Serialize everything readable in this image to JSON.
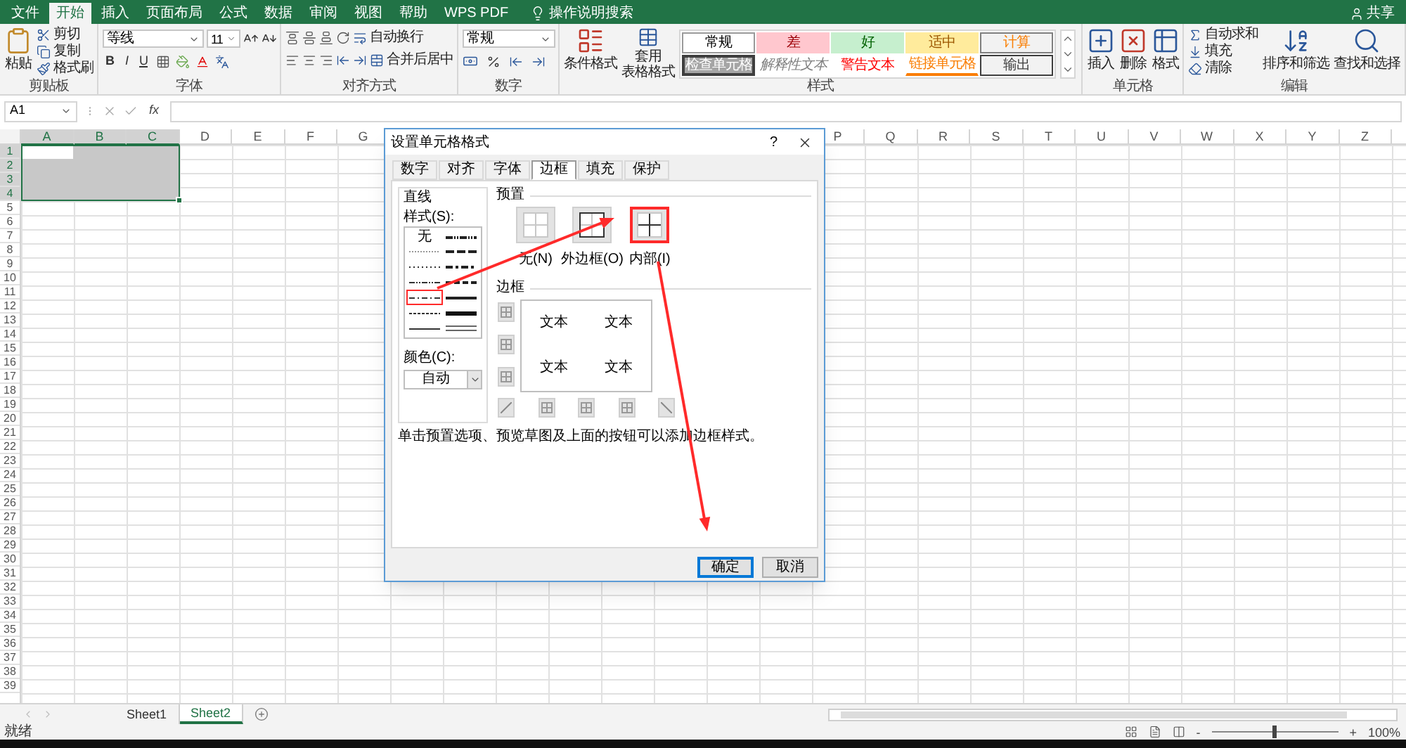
{
  "title_bar": {
    "tabs": [
      {
        "label": "文件",
        "selected": false
      },
      {
        "label": "开始",
        "selected": true
      },
      {
        "label": "插入",
        "selected": false
      },
      {
        "label": "页面布局",
        "selected": false
      },
      {
        "label": "公式",
        "selected": false
      },
      {
        "label": "数据",
        "selected": false
      },
      {
        "label": "审阅",
        "selected": false
      },
      {
        "label": "视图",
        "selected": false
      },
      {
        "label": "帮助",
        "selected": false
      },
      {
        "label": "WPS PDF",
        "selected": false
      }
    ],
    "search": "操作说明搜索",
    "share": "共享"
  },
  "ribbon": {
    "clipboard": {
      "paste": "粘贴",
      "cut": "剪切",
      "copy": "复制",
      "format_painter": "格式刷",
      "label": "剪贴板"
    },
    "font": {
      "font_name": "等线",
      "font_size": "11",
      "bold": "B",
      "italic": "I",
      "underline": "U",
      "label": "字体"
    },
    "alignment": {
      "wrap_text": "自动换行",
      "merge_center": "合并后居中",
      "label": "对齐方式"
    },
    "number": {
      "format": "常规",
      "label": "数字"
    },
    "styles": {
      "conditional": "条件格式",
      "table_format": [
        "套用",
        "表格格式"
      ],
      "label": "样式",
      "gallery": [
        {
          "label": "常规",
          "kind": "normal"
        },
        {
          "label": "差",
          "kind": "bad"
        },
        {
          "label": "好",
          "kind": "good"
        },
        {
          "label": "适中",
          "kind": "neutral"
        },
        {
          "label": "计算",
          "kind": "calculation"
        },
        {
          "label": "检查单元格",
          "kind": "check"
        },
        {
          "label": "解释性文本",
          "kind": "explanatory"
        },
        {
          "label": "警告文本",
          "kind": "warning"
        },
        {
          "label": "链接单元格",
          "kind": "linked"
        },
        {
          "label": "输出",
          "kind": "output"
        }
      ]
    },
    "cells": {
      "insert": "插入",
      "delete": "删除",
      "format": "格式",
      "label": "单元格"
    },
    "editing": {
      "autosum": "自动求和",
      "fill": "填充",
      "clear": "清除",
      "sort": "排序和筛选",
      "find": "查找和选择",
      "label": "编辑"
    }
  },
  "formula_bar": {
    "name_box": "A1",
    "fx": "fx"
  },
  "sheet": {
    "columns_left": [
      {
        "label": "A",
        "selected": true
      },
      {
        "label": "B",
        "selected": true
      },
      {
        "label": "C",
        "selected": true
      },
      {
        "label": "D",
        "selected": false
      },
      {
        "label": "E",
        "selected": false
      },
      {
        "label": "F",
        "selected": false
      },
      {
        "label": "G",
        "selected": false
      }
    ],
    "columns_right": [
      {
        "label": "P",
        "selected": false
      },
      {
        "label": "Q",
        "selected": false
      },
      {
        "label": "R",
        "selected": false
      },
      {
        "label": "S",
        "selected": false
      },
      {
        "label": "T",
        "selected": false
      },
      {
        "label": "U",
        "selected": false
      },
      {
        "label": "V",
        "selected": false
      },
      {
        "label": "W",
        "selected": false
      },
      {
        "label": "X",
        "selected": false
      },
      {
        "label": "Y",
        "selected": false
      },
      {
        "label": "Z",
        "selected": false
      }
    ],
    "rows": [
      {
        "label": "1",
        "selected": true
      },
      {
        "label": "2",
        "selected": true
      },
      {
        "label": "3",
        "selected": true
      },
      {
        "label": "4",
        "selected": true
      },
      {
        "label": "5",
        "selected": false
      },
      {
        "label": "6",
        "selected": false
      },
      {
        "label": "7",
        "selected": false
      },
      {
        "label": "8",
        "selected": false
      },
      {
        "label": "9",
        "selected": false
      },
      {
        "label": "10",
        "selected": false
      },
      {
        "label": "11",
        "selected": false
      },
      {
        "label": "12",
        "selected": false
      },
      {
        "label": "13",
        "selected": false
      },
      {
        "label": "14",
        "selected": false
      },
      {
        "label": "15",
        "selected": false
      },
      {
        "label": "16",
        "selected": false
      },
      {
        "label": "17",
        "selected": false
      },
      {
        "label": "18",
        "selected": false
      },
      {
        "label": "19",
        "selected": false
      },
      {
        "label": "20",
        "selected": false
      },
      {
        "label": "21",
        "selected": false
      },
      {
        "label": "22",
        "selected": false
      },
      {
        "label": "23",
        "selected": false
      },
      {
        "label": "24",
        "selected": false
      },
      {
        "label": "25",
        "selected": false
      },
      {
        "label": "26",
        "selected": false
      },
      {
        "label": "27",
        "selected": false
      },
      {
        "label": "28",
        "selected": false
      },
      {
        "label": "29",
        "selected": false
      },
      {
        "label": "30",
        "selected": false
      },
      {
        "label": "31",
        "selected": false
      },
      {
        "label": "32",
        "selected": false
      },
      {
        "label": "33",
        "selected": false
      },
      {
        "label": "34",
        "selected": false
      },
      {
        "label": "35",
        "selected": false
      },
      {
        "label": "36",
        "selected": false
      },
      {
        "label": "37",
        "selected": false
      },
      {
        "label": "38",
        "selected": false
      },
      {
        "label": "39",
        "selected": false
      }
    ]
  },
  "dialog": {
    "title": "设置单元格格式",
    "help": "?",
    "tabs": [
      {
        "label": "数字",
        "selected": false
      },
      {
        "label": "对齐",
        "selected": false
      },
      {
        "label": "字体",
        "selected": false
      },
      {
        "label": "边框",
        "selected": true
      },
      {
        "label": "填充",
        "selected": false
      },
      {
        "label": "保护",
        "selected": false
      }
    ],
    "line": {
      "heading": "直线",
      "style_label": "样式(S):",
      "styles": [
        {
          "kind": "none",
          "label": "无",
          "selected": false
        },
        {
          "kind": "hair",
          "selected": false
        },
        {
          "kind": "dotted",
          "selected": false
        },
        {
          "kind": "dashdotdot",
          "selected": false
        },
        {
          "kind": "dashdot",
          "selected": true
        },
        {
          "kind": "dashed",
          "selected": false
        },
        {
          "kind": "thin",
          "selected": false
        },
        {
          "kind": "mdashdotdot",
          "selected": false
        },
        {
          "kind": "mdashed",
          "selected": false
        },
        {
          "kind": "mdashdot",
          "selected": false
        },
        {
          "kind": "mslant",
          "selected": false
        },
        {
          "kind": "medium",
          "selected": false
        },
        {
          "kind": "thick",
          "selected": false
        },
        {
          "kind": "double",
          "selected": false
        }
      ],
      "color_label": "颜色(C):",
      "color_value": "自动"
    },
    "presets": {
      "heading": "预置",
      "items": [
        {
          "label": "无(N)",
          "kind": "none",
          "selected": false
        },
        {
          "label": "外边框(O)",
          "kind": "outline",
          "selected": false
        },
        {
          "label": "内部(I)",
          "kind": "inside",
          "selected": true
        }
      ]
    },
    "border": {
      "heading": "边框",
      "preview_texts": [
        "文本",
        "文本",
        "文本",
        "文本"
      ]
    },
    "hint": "单击预置选项、预览草图及上面的按钮可以添加边框样式。",
    "buttons": [
      {
        "label": "确定",
        "kind": "default"
      },
      {
        "label": "取消",
        "kind": "normal"
      }
    ]
  },
  "sheet_tabs": [
    {
      "label": "Sheet1",
      "selected": false
    },
    {
      "label": "Sheet2",
      "selected": true
    }
  ],
  "status_bar": {
    "status": "就绪",
    "zoom_out": "-",
    "zoom_in": "+",
    "zoom": "100%",
    "zoom_slider": {
      "level": 0.5
    }
  }
}
